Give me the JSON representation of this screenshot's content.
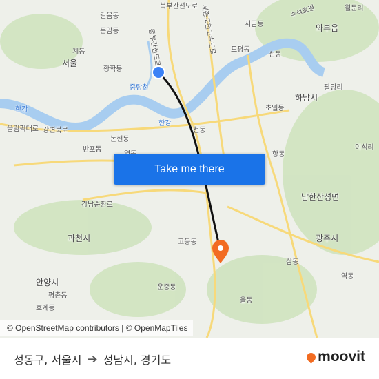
{
  "map": {
    "labels": {
      "gireum": "길음동",
      "donam": "돈암동",
      "gye": "계동",
      "seoul": "서울",
      "hwanghak": "황학동",
      "jungnangcheon": "중랑천",
      "hangang_w": "한강",
      "hangang_c": "한강",
      "olympic": "올림픽대로",
      "gangbyeon": "강변북로",
      "nonhyeon": "논현동",
      "banpo": "반포동",
      "yeok": "역동",
      "cheon": "천동",
      "jigeum": "지금동",
      "waebu": "와부읍",
      "topyeong": "토평동",
      "seon": "선동",
      "hanam": "하남시",
      "choil": "초일동",
      "hang": "항동",
      "namhansan": "남한산성면",
      "gangnamsunhwan": "강남순환로",
      "gwacheon": "과천시",
      "godeung": "고등동",
      "gwangju": "광주시",
      "sam": "삼동",
      "anyang": "안양시",
      "pyeongchon": "평촌동",
      "hogye": "호계동",
      "unjung": "운중동",
      "yul": "율동",
      "palgang": "팔당리",
      "yeok2": "역동",
      "iseok": "이석리",
      "wolmun": "월문리",
      "bukbu": "북부간선도로",
      "dongbu": "동부간선도로",
      "sejong": "세종포천고속도로",
      "sujeokho": "수석호평"
    },
    "colors": {
      "water": "#a8cdf0",
      "green": "#cfe3bf",
      "road": "#f7d97a",
      "route": "#111111",
      "origin": "#3b82f6",
      "destination": "#f26b21"
    }
  },
  "cta": {
    "label": "Take me there"
  },
  "attribution": "© OpenStreetMap contributors | © OpenMapTiles",
  "footer": {
    "origin": "성동구, 서울시",
    "arrow_icon": "arrow-right-icon",
    "destination": "성남시, 경기도",
    "brand": "moovit"
  }
}
